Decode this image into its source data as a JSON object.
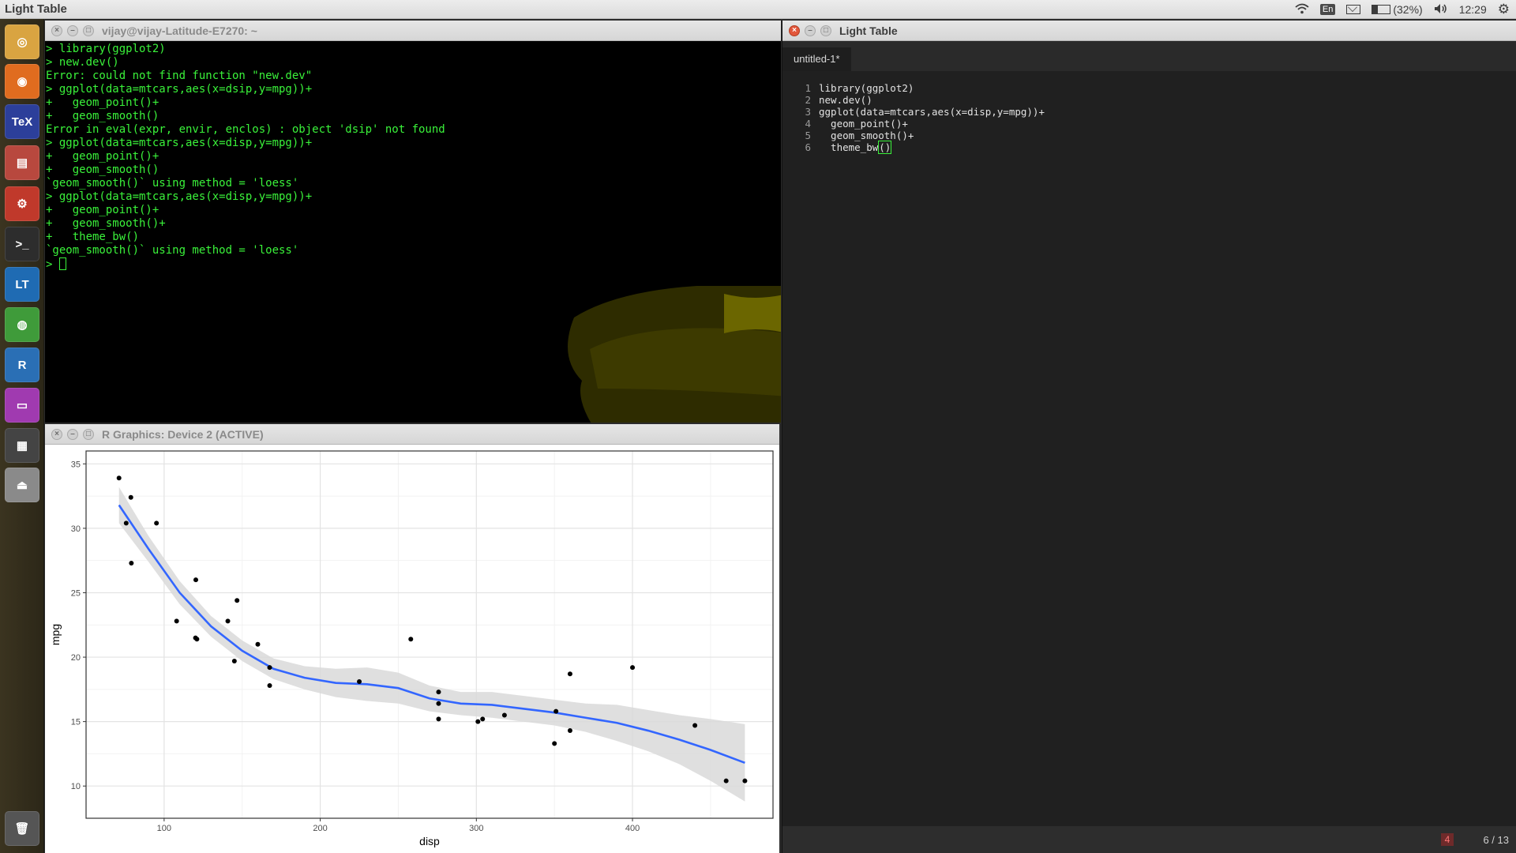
{
  "top_panel": {
    "app_title": "Light Table",
    "keyboard": "En",
    "battery_percent": "(32%)",
    "battery_level": 0.32,
    "clock": "12:29"
  },
  "launcher": {
    "items": [
      {
        "name": "ubuntu-dash",
        "icon": "ubuntu-logo-icon",
        "color": "#d9a441",
        "glyph": "◎"
      },
      {
        "name": "firefox",
        "icon": "firefox-icon",
        "color": "#e06c1f",
        "glyph": "◉"
      },
      {
        "name": "texmaker",
        "icon": "tex-icon",
        "color": "#2c3f9a",
        "glyph": "TeX"
      },
      {
        "name": "files",
        "icon": "file-cabinet-icon",
        "color": "#b8483e",
        "glyph": "▤"
      },
      {
        "name": "system-settings",
        "icon": "settings-icon",
        "color": "#c0392b",
        "glyph": "⚙"
      },
      {
        "name": "terminal",
        "icon": "terminal-icon",
        "color": "#2d2d2d",
        "glyph": ">_"
      },
      {
        "name": "light-table",
        "icon": "light-table-icon",
        "color": "#1f6bb3",
        "glyph": "LT"
      },
      {
        "name": "chrome",
        "icon": "chrome-icon",
        "color": "#3f9b3a",
        "glyph": "◍"
      },
      {
        "name": "r",
        "icon": "r-icon",
        "color": "#2a6fb5",
        "glyph": "R"
      },
      {
        "name": "window-app",
        "icon": "window-icon",
        "color": "#a03ab0",
        "glyph": "▭"
      },
      {
        "name": "workspace-switcher",
        "icon": "workspace-icon",
        "color": "#444",
        "glyph": "▦"
      },
      {
        "name": "usb-creator",
        "icon": "usb-icon",
        "color": "#8a8a8a",
        "glyph": "⏏"
      },
      {
        "name": "trash",
        "icon": "trash-icon",
        "color": "#555",
        "glyph": "🗑"
      }
    ]
  },
  "terminal": {
    "title": "vijay@vijay-Latitude-E7270: ~",
    "lines": [
      "> library(ggplot2)",
      "> new.dev()",
      "Error: could not find function \"new.dev\"",
      "> ggplot(data=mtcars,aes(x=dsip,y=mpg))+",
      "+   geom_point()+",
      "+   geom_smooth()",
      "Error in eval(expr, envir, enclos) : object 'dsip' not found",
      "> ggplot(data=mtcars,aes(x=disp,y=mpg))+",
      "+   geom_point()+",
      "+   geom_smooth()",
      "`geom_smooth()` using method = 'loess'",
      "> ggplot(data=mtcars,aes(x=disp,y=mpg))+",
      "+   geom_point()+",
      "+   geom_smooth()+",
      "+   theme_bw()",
      "`geom_smooth()` using method = 'loess'",
      "> "
    ]
  },
  "rgraphics": {
    "title": "R Graphics: Device 2 (ACTIVE)"
  },
  "chart_data": {
    "type": "scatter",
    "title": "",
    "xlabel": "disp",
    "ylabel": "mpg",
    "xlim": [
      50,
      490
    ],
    "ylim": [
      7.5,
      36
    ],
    "xticks": [
      100,
      200,
      300,
      400
    ],
    "yticks": [
      10,
      15,
      20,
      25,
      30,
      35
    ],
    "grid": true,
    "theme": "bw",
    "colors": {
      "smooth": "#3366ff",
      "ribbon": "#d9d9d9",
      "points": "#000000"
    },
    "points": [
      [
        71.1,
        33.9
      ],
      [
        75.7,
        30.4
      ],
      [
        78.7,
        32.4
      ],
      [
        79,
        27.3
      ],
      [
        95.1,
        30.4
      ],
      [
        108,
        22.8
      ],
      [
        120.1,
        21.5
      ],
      [
        120.3,
        26
      ],
      [
        121,
        21.4
      ],
      [
        140.8,
        22.8
      ],
      [
        145,
        19.7
      ],
      [
        146.7,
        24.4
      ],
      [
        160,
        21
      ],
      [
        167.6,
        19.2
      ],
      [
        167.6,
        17.8
      ],
      [
        225,
        18.1
      ],
      [
        258,
        21.4
      ],
      [
        275.8,
        17.3
      ],
      [
        275.8,
        16.4
      ],
      [
        275.8,
        15.2
      ],
      [
        301,
        15
      ],
      [
        304,
        15.2
      ],
      [
        318,
        15.5
      ],
      [
        350,
        13.3
      ],
      [
        351,
        15.8
      ],
      [
        360,
        18.7
      ],
      [
        360,
        14.3
      ],
      [
        400,
        19.2
      ],
      [
        440,
        14.7
      ],
      [
        460,
        10.4
      ],
      [
        472,
        10.4
      ]
    ],
    "smooth": {
      "x": [
        71.1,
        90,
        110,
        130,
        150,
        170,
        190,
        210,
        230,
        250,
        270,
        290,
        310,
        330,
        350,
        370,
        390,
        410,
        430,
        450,
        472
      ],
      "y": [
        31.8,
        28.4,
        25.0,
        22.4,
        20.5,
        19.1,
        18.4,
        18.0,
        17.9,
        17.6,
        16.8,
        16.4,
        16.3,
        16.0,
        15.7,
        15.3,
        14.9,
        14.3,
        13.6,
        12.8,
        11.8
      ],
      "ymin": [
        30.4,
        27.4,
        24.1,
        21.6,
        19.7,
        18.3,
        17.5,
        16.9,
        16.6,
        16.4,
        15.8,
        15.5,
        15.3,
        15.0,
        14.7,
        14.2,
        13.5,
        12.7,
        11.7,
        10.4,
        8.8
      ],
      "ymax": [
        33.2,
        29.4,
        25.9,
        23.2,
        21.3,
        19.9,
        19.3,
        19.1,
        19.2,
        18.8,
        17.8,
        17.3,
        17.3,
        17.0,
        16.7,
        16.4,
        16.3,
        15.9,
        15.5,
        15.2,
        14.8
      ]
    }
  },
  "lighttable": {
    "title": "Light Table",
    "tab_label": "untitled-1*",
    "code": [
      {
        "num": "1",
        "text": "library(ggplot2)"
      },
      {
        "num": "2",
        "text": "new.dev()"
      },
      {
        "num": "3",
        "text": "ggplot(data=mtcars,aes(x=disp,y=mpg))+"
      },
      {
        "num": "4",
        "text": "  geom_point()+"
      },
      {
        "num": "5",
        "text": "  geom_smooth()+"
      },
      {
        "num": "6",
        "text": "  theme_bw"
      }
    ],
    "last_line_paren": "()",
    "error_count": "4",
    "position": "6 / 13"
  }
}
